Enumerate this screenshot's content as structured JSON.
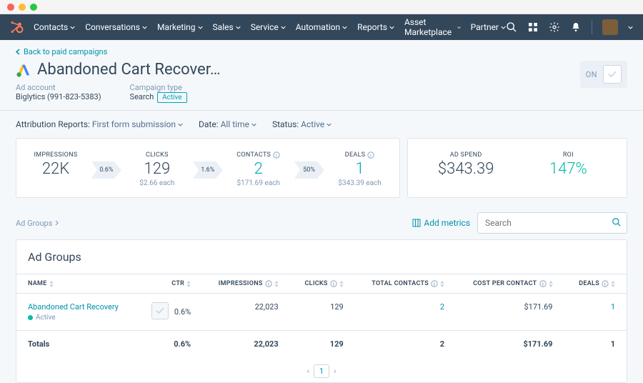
{
  "nav": [
    "Contacts",
    "Conversations",
    "Marketing",
    "Sales",
    "Service",
    "Automation",
    "Reports",
    "Asset Marketplace",
    "Partner"
  ],
  "back": "Back to paid campaigns",
  "title": "Abandoned Cart Recover…",
  "meta": {
    "adaccount_label": "Ad account",
    "adaccount_value": "Biglytics (991-823-5383)",
    "campaign_type_label": "Campaign type",
    "campaign_type_value": "Search",
    "status_badge": "Active"
  },
  "toggle_label": "ON",
  "filters": {
    "attr_label": "Attribution Reports:",
    "attr_value": "First form submission",
    "date_label": "Date:",
    "date_value": "All time",
    "status_label": "Status:",
    "status_value": "Active"
  },
  "funnel": {
    "impressions": {
      "label": "IMPRESSIONS",
      "value": "22K"
    },
    "pct1": "0.6%",
    "clicks": {
      "label": "CLICKS",
      "value": "129",
      "sub": "$2.66 each"
    },
    "pct2": "1.6%",
    "contacts": {
      "label": "CONTACTS",
      "value": "2",
      "sub": "$171.69 each"
    },
    "pct3": "50%",
    "deals": {
      "label": "DEALS",
      "value": "1",
      "sub": "$343.39 each"
    }
  },
  "spend": {
    "adspend": {
      "label": "AD SPEND",
      "value": "$343.39"
    },
    "roi": {
      "label": "ROI",
      "value": "147%"
    }
  },
  "breadcrumb": "Ad Groups",
  "add_metrics": "Add metrics",
  "search_placeholder": "Search",
  "table": {
    "title": "Ad Groups",
    "headers": [
      "NAME",
      "CTR",
      "IMPRESSIONS",
      "CLICKS",
      "TOTAL CONTACTS",
      "COST PER CONTACT",
      "DEALS"
    ],
    "rows": [
      {
        "name": "Abandoned Cart Recovery",
        "status": "Active",
        "ctr": "0.6%",
        "impressions": "22,023",
        "clicks": "129",
        "contacts": "2",
        "cost": "$171.69",
        "deals": "1"
      }
    ],
    "totals": {
      "label": "Totals",
      "ctr": "0.6%",
      "impressions": "22,023",
      "clicks": "129",
      "contacts": "2",
      "cost": "$171.69",
      "deals": "1"
    }
  },
  "pager": {
    "prev": "‹",
    "page": "1",
    "next": "›"
  }
}
